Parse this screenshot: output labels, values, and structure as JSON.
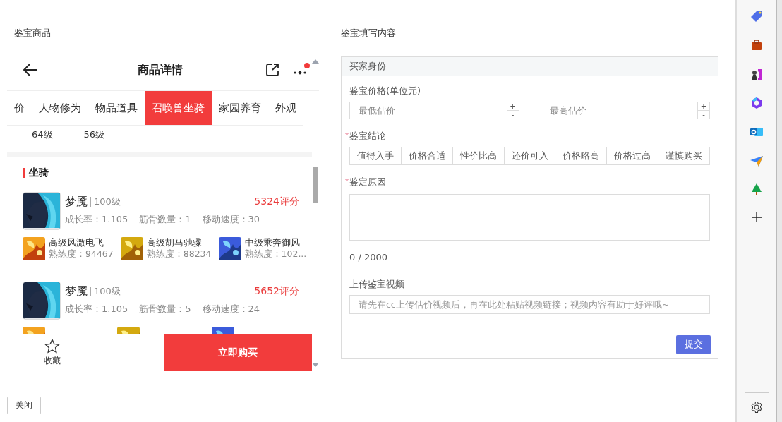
{
  "left_panel": {
    "title": "鉴宝商品",
    "product_view": {
      "title": "商品详情",
      "tabs": [
        {
          "label": "价",
          "selected": false
        },
        {
          "label": "人物修为",
          "selected": false
        },
        {
          "label": "物品道具",
          "selected": false
        },
        {
          "label": "召唤兽坐骑",
          "selected": true
        },
        {
          "label": "家园养育",
          "selected": false
        },
        {
          "label": "外观",
          "selected": false
        }
      ],
      "level_labels": [
        "64级",
        "56级"
      ],
      "section_title": "坐骑",
      "mounts": [
        {
          "name": "梦魇",
          "level": "100级",
          "score": "5324评分",
          "stats": [
            "成长率：1.105",
            "筋骨数量：1",
            "移动速度：30"
          ],
          "skills": [
            {
              "name": "高级风激电飞",
              "proficiency": "熟练度：94467"
            },
            {
              "name": "高级胡马驰骤",
              "proficiency": "熟练度：88234"
            },
            {
              "name": "中级乘奔御风",
              "proficiency": "熟练度：102..."
            }
          ]
        },
        {
          "name": "梦魇",
          "level": "100级",
          "score": "5652评分",
          "stats": [
            "成长率：1.105",
            "筋骨数量：5",
            "移动速度：24"
          ]
        }
      ],
      "favorite_label": "收藏",
      "buy_button": "立即购买"
    }
  },
  "right_panel": {
    "title": "鉴宝填写内容",
    "section_title": "买家身份",
    "price_label": "鉴宝价格(单位元)",
    "price_fields": [
      {
        "placeholder": "最低估价"
      },
      {
        "placeholder": "最高估价"
      }
    ],
    "spinner": {
      "up": "+",
      "down": "-"
    },
    "conclusion_label": "鉴宝结论",
    "conclusion_required_mark": "*",
    "conclusions": [
      {
        "label": "值得入手",
        "selected": false
      },
      {
        "label": "价格合适",
        "selected": false
      },
      {
        "label": "性价比高",
        "selected": false
      },
      {
        "label": "还价可入",
        "selected": false
      },
      {
        "label": "价格略高",
        "selected": false
      },
      {
        "label": "价格过高",
        "selected": false
      },
      {
        "label": "谨慎购买",
        "selected": false
      }
    ],
    "reason_label": "鉴定原因",
    "reason_required_mark": "*",
    "reason_counter": "0 / 2000",
    "video_label": "上传鉴宝视频",
    "video_field": {
      "placeholder": "请先在cc上传估价视频后，再在此处粘贴视频链接；视频内容有助于好评哦~"
    },
    "submit_button": "提交"
  },
  "footer": {
    "close_button": "关闭"
  }
}
